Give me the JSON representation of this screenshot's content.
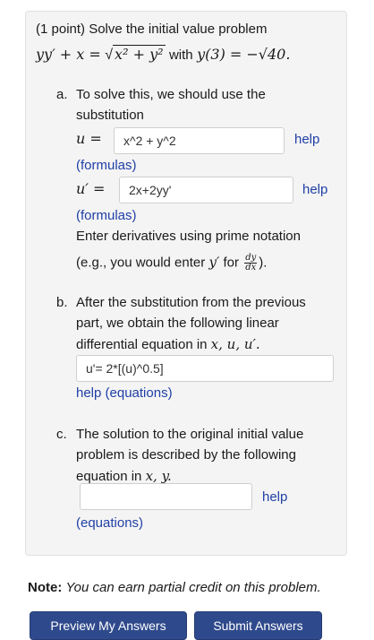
{
  "problem": {
    "points": "(1 point)",
    "intro": "Solve the initial value problem",
    "equation_lhs": "yy′ + x =",
    "equation_radicand": "x² + y²",
    "with_text": "with",
    "initial_condition": "y(3) = −√40."
  },
  "part_a": {
    "letter": "a.",
    "text_line1": "To solve this, we should use the",
    "text_line2": "substitution",
    "u_label": "u =",
    "u_value": "x^2 + y^2",
    "help_label": "help",
    "formulas_label": "(formulas)",
    "uprime_label": "u′ =",
    "uprime_value": "2x+2yy'",
    "help2_label": "help",
    "formulas2_label": "(formulas)",
    "deriv_note": "Enter derivatives using prime notation",
    "eg_text": "(e.g., you would enter",
    "eg_yprime": "y′",
    "eg_for": "for",
    "frac_num": "dy",
    "frac_den": "dx",
    "eg_close": ")."
  },
  "part_b": {
    "letter": "b.",
    "line1": "After the substitution from the previous",
    "line2": "part, we obtain the following linear",
    "line3": "differential equation in",
    "vars": "x, u, u′.",
    "answer_value": "u'= 2*[(u)^0.5]",
    "help_label": "help (equations)"
  },
  "part_c": {
    "letter": "c.",
    "line1": "The solution to the original initial value",
    "line2": "problem is described by the following",
    "line3": "equation in",
    "vars": "x, y.",
    "answer_value": "",
    "help_label": "help",
    "equations_label": "(equations)"
  },
  "note": {
    "bold": "Note:",
    "text": "You can earn partial credit on this problem."
  },
  "buttons": {
    "preview": "Preview My Answers",
    "submit": "Submit Answers"
  }
}
